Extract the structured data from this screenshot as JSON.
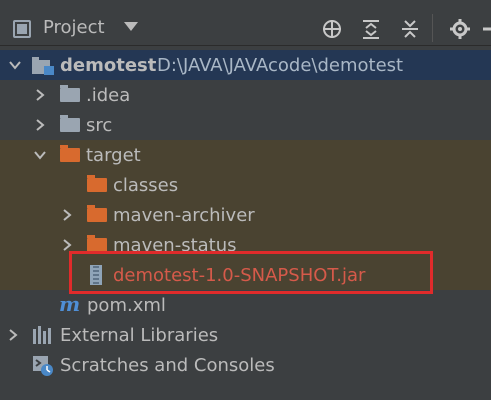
{
  "toolbar": {
    "title": "Project",
    "icons": [
      "locate-icon",
      "collapse-all-icon",
      "expand-all-icon",
      "settings-icon"
    ]
  },
  "tree": {
    "root": {
      "name": "demotest",
      "path": "D:\\JAVA\\JAVAcode\\demotest"
    },
    "idea": ".idea",
    "src": "src",
    "target": "target",
    "classes": "classes",
    "maven_archiver": "maven-archiver",
    "maven_status": "maven-status",
    "jar": "demotest-1.0-SNAPSHOT.jar",
    "pom": "pom.xml",
    "external_libraries": "External Libraries",
    "scratches": "Scratches and Consoles"
  },
  "colors": {
    "background": "#3c3f41",
    "target_band": "#4a4331",
    "selected_row": "#243754",
    "highlight": "#e02b2b",
    "jar_text": "#d65a4a",
    "folder_orange": "#d86a2e"
  }
}
